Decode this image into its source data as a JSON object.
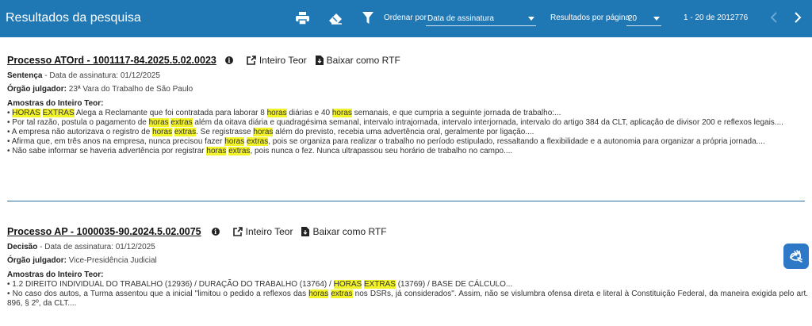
{
  "header": {
    "title": "Resultados da pesquisa",
    "sort_label": "Ordenar por",
    "sort_value": "Data de assinatura",
    "per_page_label": "Resultados por página",
    "per_page_value": "20",
    "range": "1 - 20 de 2012776",
    "prev_icon": "chevron-left-icon",
    "next_icon": "chevron-right-icon"
  },
  "results": [
    {
      "title": "Processo ATOrd - 1001117-84.2025.5.02.0023",
      "full_text_label": "Inteiro Teor",
      "rtf_label": "Baixar como RTF",
      "doc_type": "Sentença",
      "date_text": "- Data de assinatura: 01/12/2025",
      "court_label": "Órgão julgador:",
      "court_value": "23ª Vara do Trabalho de São Paulo",
      "samples_label": "Amostras do Inteiro Teor:",
      "snippets": [
        [
          {
            "t": "• ",
            "h": false
          },
          {
            "t": "HORAS",
            "h": true
          },
          {
            "t": " ",
            "h": false
          },
          {
            "t": "EXTRAS",
            "h": true
          },
          {
            "t": " Alega a Reclamante que foi contratada para laborar 8 ",
            "h": false
          },
          {
            "t": "horas",
            "h": true
          },
          {
            "t": " diárias e 40 ",
            "h": false
          },
          {
            "t": "horas",
            "h": true
          },
          {
            "t": " semanais, e que cumpria a seguinte jornada de trabalho:...",
            "h": false
          }
        ],
        [
          {
            "t": "• Por tal razão, postula o pagamento de ",
            "h": false
          },
          {
            "t": "horas",
            "h": true
          },
          {
            "t": " ",
            "h": false
          },
          {
            "t": "extras",
            "h": true
          },
          {
            "t": " além da oitava diária e quadragésima semanal, intervalo intrajornada, intervalo interjornada, intervalo do artigo 384 da CLT, aplicação de divisor 200 e reflexos legais....",
            "h": false
          }
        ],
        [
          {
            "t": "• A empresa não autorizava o registro de ",
            "h": false
          },
          {
            "t": "horas",
            "h": true
          },
          {
            "t": " ",
            "h": false
          },
          {
            "t": "extras",
            "h": true
          },
          {
            "t": ". Se registrasse ",
            "h": false
          },
          {
            "t": "horas",
            "h": true
          },
          {
            "t": " além do previsto, recebia uma advertência oral, geralmente por ligação....",
            "h": false
          }
        ],
        [
          {
            "t": "• Afirma que, em três anos na empresa, nunca precisou fazer ",
            "h": false
          },
          {
            "t": "horas",
            "h": true
          },
          {
            "t": " ",
            "h": false
          },
          {
            "t": "extras",
            "h": true
          },
          {
            "t": ", pois se organiza para realizar o trabalho no período estipulado, ressaltando a flexibilidade e a autonomia para organizar a própria jornada....",
            "h": false
          }
        ],
        [
          {
            "t": "• Não sabe informar se haveria advertência por registrar ",
            "h": false
          },
          {
            "t": "horas",
            "h": true
          },
          {
            "t": " ",
            "h": false
          },
          {
            "t": "extras",
            "h": true
          },
          {
            "t": ", pois nunca o fez. Nunca ultrapassou seu horário de trabalho no campo....",
            "h": false
          }
        ]
      ]
    },
    {
      "title": "Processo AP - 1000035-90.2024.5.02.0075",
      "full_text_label": "Inteiro Teor",
      "rtf_label": "Baixar como RTF",
      "doc_type": "Decisão",
      "date_text": "- Data de assinatura: 01/12/2025",
      "court_label": "Órgão julgador:",
      "court_value": "Vice-Presidência Judicial",
      "samples_label": "Amostras do Inteiro Teor:",
      "snippets": [
        [
          {
            "t": "• 1.2  DIREITO INDIVIDUAL DO TRABALHO (12936) / DURAÇÃO DO TRABALHO (13764) / ",
            "h": false
          },
          {
            "t": "HORAS",
            "h": true
          },
          {
            "t": " ",
            "h": false
          },
          {
            "t": "EXTRAS",
            "h": true
          },
          {
            "t": " (13769) / BASE DE CÁLCULO...",
            "h": false
          }
        ],
        [
          {
            "t": "• No caso dos autos, a Turma assentou que a inicial \"limitou o pedido a reflexos das ",
            "h": false
          },
          {
            "t": "horas",
            "h": true
          },
          {
            "t": " ",
            "h": false
          },
          {
            "t": "extras",
            "h": true
          },
          {
            "t": " nos DSRs, já considerados\".  Assim, não se vislumbra ofensa direta e literal à Constituição Federal, da maneira exigida pelo art. 896, § 2º, da CLT....",
            "h": false
          }
        ]
      ]
    }
  ],
  "colors": {
    "header_bg": "#1f77b4",
    "highlight": "#f3f32a",
    "divider": "#2a6fa6",
    "accessibility_button": "#2d79c7"
  }
}
